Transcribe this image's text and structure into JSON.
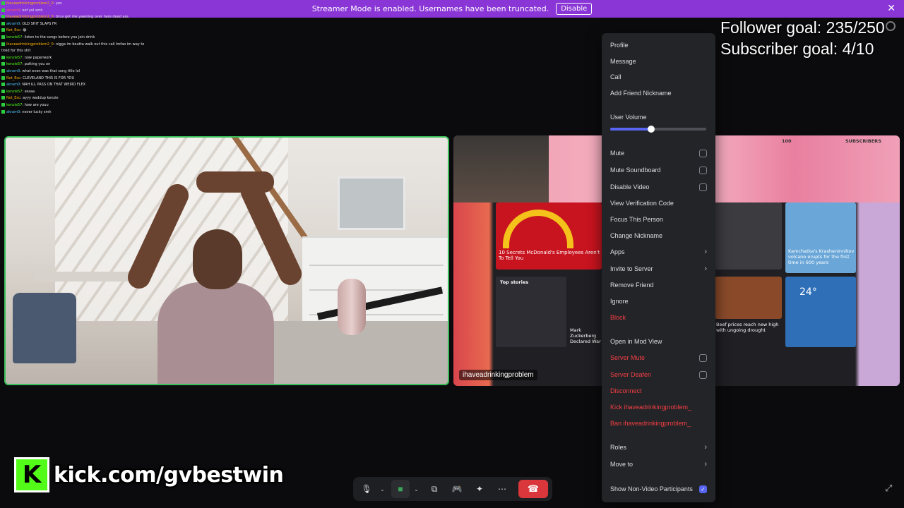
{
  "banner": {
    "message": "Streamer Mode is enabled. Usernames have been truncated.",
    "disable_label": "Disable",
    "close_label": "✕"
  },
  "chat": [
    {
      "user": "ihaveadrinkingproblem2_0",
      "text": ": yes",
      "color": "orange"
    },
    {
      "user": "akram0",
      "text": ": oof yol smh",
      "color": "red"
    },
    {
      "user": "ihaveadrinkingproblem2_0",
      "text": ": bruv got me yawning over here dead ass",
      "color": "orange"
    },
    {
      "user": "akram0",
      "text": ": OLD SHIT SLAPS FR",
      "color": "blue"
    },
    {
      "user": "Not_Esc",
      "text": ": 😂",
      "color": "orange"
    },
    {
      "user": "kenzie57",
      "text": ": listen to the songs before you join drink",
      "color": "green"
    },
    {
      "user": "ihaveadrinkingproblem2_0",
      "text": ": nigga im boutta walk out this call lmfao im way to",
      "color": "orange"
    },
    {
      "user": "",
      "text": "tired for this shit",
      "color": ""
    },
    {
      "user": "kenzie57",
      "text": ": now paperwork",
      "color": "green"
    },
    {
      "user": "kenzie57",
      "text": ": putting you on",
      "color": "green"
    },
    {
      "user": "akram0",
      "text": ": what even was that song title lol",
      "color": "blue"
    },
    {
      "user": "Not_Esc",
      "text": ": CLEVELAND THIS IS FOR YOU",
      "color": "orange"
    },
    {
      "user": "akram0",
      "text": ": NAH ILL PASS ON THAT WEIRD FLEX",
      "color": "blue"
    },
    {
      "user": "kenzie57",
      "text": ": essaa",
      "color": "green"
    },
    {
      "user": "Not_Esc",
      "text": ": ayyy wsddup kenzie",
      "color": "orange"
    },
    {
      "user": "kenzie57",
      "text": ": how are youu",
      "color": "green"
    },
    {
      "user": "akram0",
      "text": ": never lucky smh",
      "color": "blue"
    }
  ],
  "goals": {
    "follower": "Follower goal: 235/250",
    "subscriber": "Subscriber goal: 4/10"
  },
  "screen_share": {
    "participant": "ihaveadrinkingproblem",
    "headline": "10 Secrets McDonald's Employees Aren't To Tell You",
    "story2": "Kamchatka's Krasheninnikov volcano erupts for the first time in 600 years",
    "story3": "Beef prices reach new high with ungoing drought",
    "story4": "Mark Zuckerberg Declared War",
    "top_stories": "Top stories",
    "weather_temp": "24°",
    "tab_label": "SUBSCRIBERS",
    "count_label": "100"
  },
  "menu": {
    "items": [
      {
        "label": "Profile"
      },
      {
        "label": "Message"
      },
      {
        "label": "Call"
      },
      {
        "label": "Add Friend Nickname"
      }
    ],
    "volume_label": "User Volume",
    "volume_level": 0.43,
    "toggles": [
      {
        "label": "Mute",
        "checked": false
      },
      {
        "label": "Mute Soundboard",
        "checked": false
      },
      {
        "label": "Disable Video",
        "checked": false
      }
    ],
    "actions": [
      {
        "label": "View Verification Code"
      },
      {
        "label": "Focus This Person"
      },
      {
        "label": "Change Nickname"
      },
      {
        "label": "Apps",
        "submenu": true
      },
      {
        "label": "Invite to Server",
        "submenu": true
      },
      {
        "label": "Remove Friend"
      },
      {
        "label": "Ignore"
      },
      {
        "label": "Block",
        "danger": true
      }
    ],
    "mod": [
      {
        "label": "Open in Mod View"
      },
      {
        "label": "Server Mute",
        "danger": true,
        "checkbox": true
      },
      {
        "label": "Server Deafen",
        "danger": true,
        "checkbox": true
      },
      {
        "label": "Disconnect",
        "danger": true
      },
      {
        "label": "Kick ihaveadrinkingproblem_",
        "danger": true
      },
      {
        "label": "Ban ihaveadrinkingproblem_",
        "danger": true
      }
    ],
    "bottom": [
      {
        "label": "Roles",
        "submenu": true
      },
      {
        "label": "Move to",
        "submenu": true
      }
    ],
    "show_non_video": {
      "label": "Show Non-Video Participants",
      "checked": true
    }
  },
  "branding": {
    "kick_letter": "K",
    "kick_url": "kick.com/gvbestwin"
  },
  "controls": {
    "mic": "🎙",
    "camera": "■",
    "screen": "⧉",
    "activity": "🎮",
    "soundboard": "✦",
    "more": "⋯",
    "hangup": "☎",
    "fullscreen": "⤢"
  },
  "colors": {
    "banner": "#8a35d6",
    "accent": "#5865f2",
    "danger": "#f23f43",
    "speaking_border": "#3cbf5a",
    "kick_green": "#53fc18"
  }
}
